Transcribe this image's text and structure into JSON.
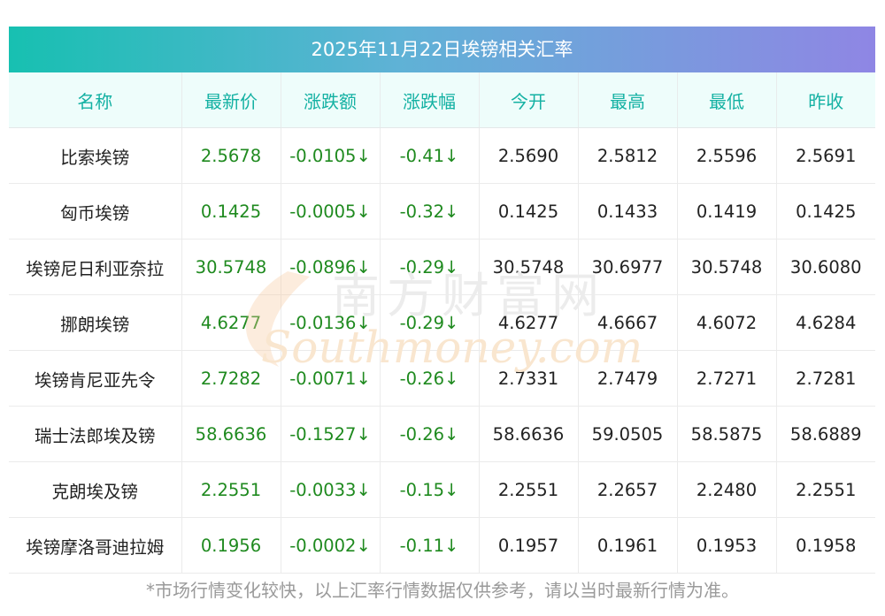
{
  "title": "2025年11月22日埃镑相关汇率",
  "columns": [
    "名称",
    "最新价",
    "涨跌额",
    "涨跌幅",
    "今开",
    "最高",
    "最低",
    "昨收"
  ],
  "rows": [
    {
      "name": "比索埃镑",
      "latest": "2.5678",
      "change": "-0.0105↓",
      "pct": "-0.41↓",
      "open": "2.5690",
      "high": "2.5812",
      "low": "2.5596",
      "prev": "2.5691"
    },
    {
      "name": "匈币埃镑",
      "latest": "0.1425",
      "change": "-0.0005↓",
      "pct": "-0.32↓",
      "open": "0.1425",
      "high": "0.1433",
      "low": "0.1419",
      "prev": "0.1425"
    },
    {
      "name": "埃镑尼日利亚奈拉",
      "latest": "30.5748",
      "change": "-0.0896↓",
      "pct": "-0.29↓",
      "open": "30.5748",
      "high": "30.6977",
      "low": "30.5748",
      "prev": "30.6080"
    },
    {
      "name": "挪朗埃镑",
      "latest": "4.6277",
      "change": "-0.0136↓",
      "pct": "-0.29↓",
      "open": "4.6277",
      "high": "4.6667",
      "low": "4.6072",
      "prev": "4.6284"
    },
    {
      "name": "埃镑肯尼亚先令",
      "latest": "2.7282",
      "change": "-0.0071↓",
      "pct": "-0.26↓",
      "open": "2.7331",
      "high": "2.7479",
      "low": "2.7271",
      "prev": "2.7281"
    },
    {
      "name": "瑞士法郎埃及镑",
      "latest": "58.6636",
      "change": "-0.1527↓",
      "pct": "-0.26↓",
      "open": "58.6636",
      "high": "59.0505",
      "low": "58.5875",
      "prev": "58.6889"
    },
    {
      "name": "克朗埃及镑",
      "latest": "2.2551",
      "change": "-0.0033↓",
      "pct": "-0.15↓",
      "open": "2.2551",
      "high": "2.2657",
      "low": "2.2480",
      "prev": "2.2551"
    },
    {
      "name": "埃镑摩洛哥迪拉姆",
      "latest": "0.1956",
      "change": "-0.0002↓",
      "pct": "-0.11↓",
      "open": "0.1957",
      "high": "0.1961",
      "low": "0.1953",
      "prev": "0.1958"
    }
  ],
  "note": "*市场行情变化较快，以上汇率行情数据仅供参考，请以当时最新行情为准。",
  "watermark": {
    "cn": "南方财富网",
    "en": "Southmoney.com"
  },
  "colors": {
    "header_text": "#14b1a3",
    "up_down_green": "#1f8a1f",
    "header_bg": "#eefdfb"
  }
}
